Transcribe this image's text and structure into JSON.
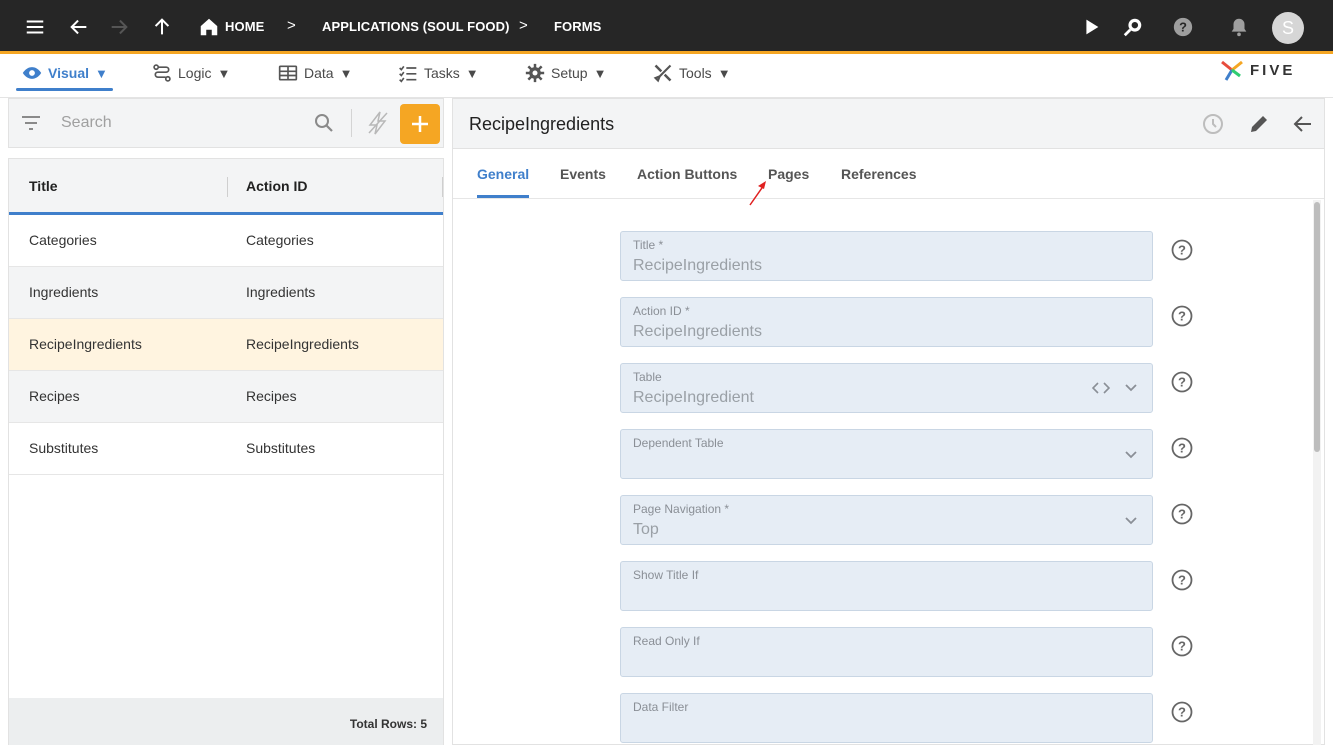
{
  "topbar": {
    "breadcrumbs": [
      {
        "label": "HOME",
        "icon": "home-icon"
      },
      {
        "label": "APPLICATIONS (SOUL FOOD)"
      },
      {
        "label": "FORMS"
      }
    ],
    "avatar_initial": "S",
    "accent_color": "#f5a623"
  },
  "menu": {
    "items": [
      {
        "label": "Visual",
        "icon": "eye-icon",
        "active": true
      },
      {
        "label": "Logic",
        "icon": "logic-icon"
      },
      {
        "label": "Data",
        "icon": "table-icon"
      },
      {
        "label": "Tasks",
        "icon": "tasks-icon"
      },
      {
        "label": "Setup",
        "icon": "gear-icon"
      },
      {
        "label": "Tools",
        "icon": "tools-icon"
      }
    ],
    "caret": "▼",
    "brand": "FIVE"
  },
  "left": {
    "search_placeholder": "Search",
    "columns": [
      "Title",
      "Action ID"
    ],
    "rows": [
      {
        "title": "Categories",
        "action_id": "Categories"
      },
      {
        "title": "Ingredients",
        "action_id": "Ingredients"
      },
      {
        "title": "RecipeIngredients",
        "action_id": "RecipeIngredients"
      },
      {
        "title": "Recipes",
        "action_id": "Recipes"
      },
      {
        "title": "Substitutes",
        "action_id": "Substitutes"
      }
    ],
    "total_rows": "Total Rows: 5"
  },
  "right": {
    "title": "RecipeIngredients",
    "tabs": [
      "General",
      "Events",
      "Action Buttons",
      "Pages",
      "References"
    ],
    "fields": [
      {
        "label": "Title *",
        "value": "RecipeIngredients"
      },
      {
        "label": "Action ID *",
        "value": "RecipeIngredients"
      },
      {
        "label": "Table",
        "value": "RecipeIngredient"
      },
      {
        "label": "Dependent Table",
        "value": ""
      },
      {
        "label": "Page Navigation *",
        "value": "Top"
      },
      {
        "label": "Show Title If",
        "value": ""
      },
      {
        "label": "Read Only If",
        "value": ""
      },
      {
        "label": "Data Filter",
        "value": ""
      }
    ]
  }
}
